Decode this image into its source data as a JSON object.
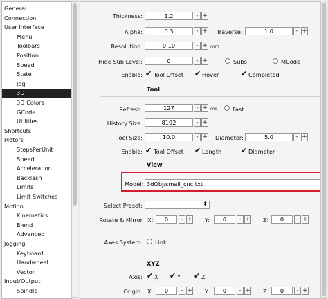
{
  "tree": {
    "items": [
      {
        "label": "General",
        "level": 0
      },
      {
        "label": "Connection",
        "level": 0
      },
      {
        "label": "User Interface",
        "level": 0
      },
      {
        "label": "Menu",
        "level": 1
      },
      {
        "label": "Toolbars",
        "level": 1
      },
      {
        "label": "Position",
        "level": 1
      },
      {
        "label": "Speed",
        "level": 1
      },
      {
        "label": "State",
        "level": 1
      },
      {
        "label": "Jog",
        "level": 1
      },
      {
        "label": "3D",
        "level": 1,
        "selected": true
      },
      {
        "label": "3D Colors",
        "level": 1
      },
      {
        "label": "GCode",
        "level": 1
      },
      {
        "label": "Utilities",
        "level": 1
      },
      {
        "label": "Shortcuts",
        "level": 0
      },
      {
        "label": "Motors",
        "level": 0
      },
      {
        "label": "StepsPerUnit",
        "level": 1
      },
      {
        "label": "Speed",
        "level": 1
      },
      {
        "label": "Acceleration",
        "level": 1
      },
      {
        "label": "Backlash",
        "level": 1
      },
      {
        "label": "Limits",
        "level": 1
      },
      {
        "label": "Limit Switches",
        "level": 1
      },
      {
        "label": "Motion",
        "level": 0
      },
      {
        "label": "Kinematics",
        "level": 1
      },
      {
        "label": "Blend",
        "level": 1
      },
      {
        "label": "Advanced",
        "level": 1
      },
      {
        "label": "Jogging",
        "level": 0
      },
      {
        "label": "Keyboard",
        "level": 1
      },
      {
        "label": "Handwheel",
        "level": 1
      },
      {
        "label": "Vector",
        "level": 1
      },
      {
        "label": "Input/Output",
        "level": 0
      },
      {
        "label": "Spindle",
        "level": 1
      }
    ]
  },
  "view3d": {
    "thickness": {
      "label": "Thickness:",
      "value": "1.2"
    },
    "alpha": {
      "label": "Alpha:",
      "value": "0.3"
    },
    "traverse": {
      "label": "Traverse:",
      "value": "1.0"
    },
    "resolution": {
      "label": "Resolution:",
      "value": "0.10",
      "unit": "mm"
    },
    "hide_sub_level": {
      "label": "Hide Sub Level:",
      "value": "0",
      "subs": "Subs",
      "mcode": "MCode"
    },
    "enable": {
      "label": "Enable:",
      "tool_offset": "Tool Offset",
      "hover": "Hover",
      "completed": "Completed"
    }
  },
  "tool": {
    "heading": "Tool",
    "refresh": {
      "label": "Refresh:",
      "value": "127",
      "unit": "ms",
      "fast": "Fast"
    },
    "history_size": {
      "label": "History Size:",
      "value": "8192"
    },
    "tool_size": {
      "label": "Tool Size:",
      "value": "10.0"
    },
    "diameter": {
      "label": "Diameter:",
      "value": "5.0"
    },
    "enable": {
      "label": "Enable:",
      "tool_offset": "Tool Offset",
      "length": "Length",
      "diameter": "Diameter"
    }
  },
  "view": {
    "heading": "View",
    "model": {
      "label": "Model:",
      "value": "3dObj/small_cnc.txt"
    },
    "select_preset": {
      "label": "Select Preset:",
      "value": ""
    },
    "rotate_mirror": {
      "label": "Rotate & Mirror",
      "x_label": "X:",
      "x": "0",
      "y_label": "Y:",
      "y": "0",
      "z_label": "Z:",
      "z": "0"
    },
    "axes_system": {
      "label": "Axes System:",
      "link": "Link"
    }
  },
  "xyz": {
    "heading": "XYZ",
    "axis": {
      "label": "Axis:",
      "x": "X",
      "y": "Y",
      "z": "Z"
    },
    "origin": {
      "label": "Origin:",
      "x_label": "X:",
      "x": "0",
      "y_label": "Y:",
      "y": "0",
      "z_label": "Z:",
      "z": "0"
    }
  },
  "spin": {
    "minus": "-",
    "plus": "+"
  },
  "glyphs": {
    "check": "✔",
    "dropdown": "⬍"
  },
  "colors": {
    "selection": "#222222",
    "highlight_border": "#d21f2b"
  }
}
